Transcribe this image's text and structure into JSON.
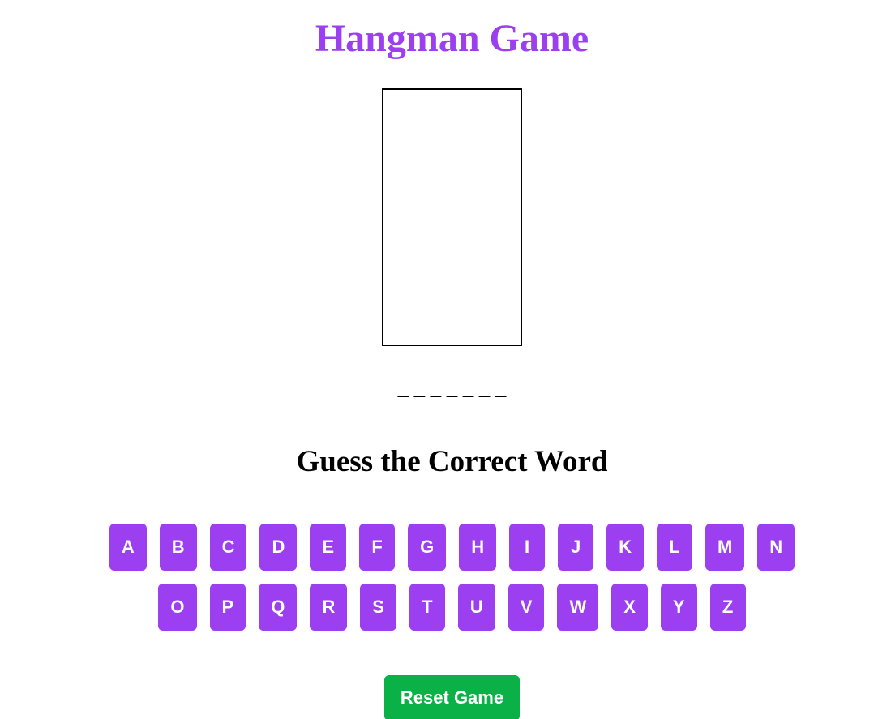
{
  "game": {
    "title": "Hangman Game",
    "word_display": "_ _ _ _ _ _ _",
    "prompt": "Guess the Correct Word",
    "reset_label": "Reset Game"
  },
  "keyboard": {
    "row1": [
      "A",
      "B",
      "C",
      "D",
      "E",
      "F",
      "G",
      "H",
      "I",
      "J",
      "K",
      "L",
      "M",
      "N"
    ],
    "row2": [
      "O",
      "P",
      "Q",
      "R",
      "S",
      "T",
      "U",
      "V",
      "W",
      "X",
      "Y",
      "Z"
    ]
  },
  "colors": {
    "accent": "#9b3ff0",
    "reset": "#0ab146",
    "text": "#000000"
  }
}
